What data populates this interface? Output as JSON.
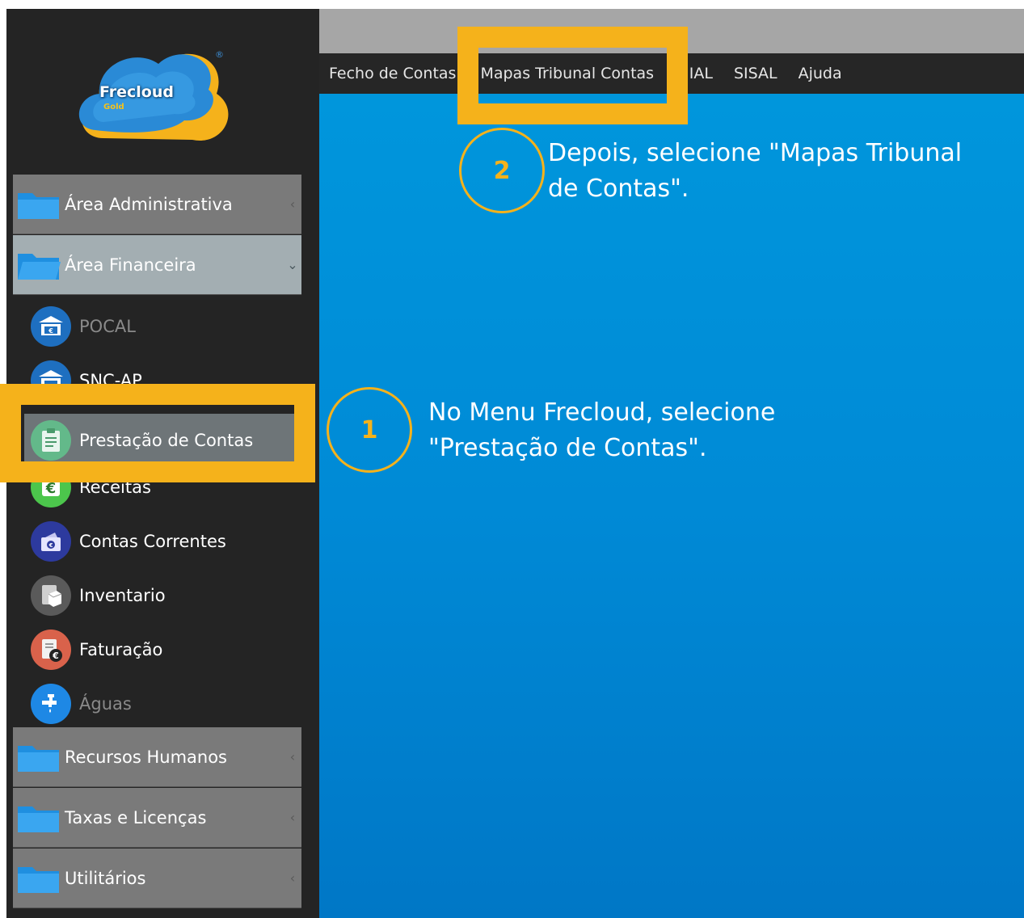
{
  "app": {
    "logo_text": "Frecloud",
    "logo_sub": "Gold",
    "logo_reg": "®"
  },
  "sidebar": {
    "areas": [
      {
        "label": "Área Administrativa",
        "expanded": false
      },
      {
        "label": "Área Financeira",
        "expanded": true
      },
      {
        "label": "Recursos Humanos",
        "expanded": false
      },
      {
        "label": "Taxas e Licenças",
        "expanded": false
      },
      {
        "label": "Utilitários",
        "expanded": false
      }
    ],
    "financeira_items": [
      {
        "label": "POCAL",
        "icon": "bank-icon",
        "enabled": false
      },
      {
        "label": "SNC-AP",
        "icon": "bank-icon",
        "enabled": true
      },
      {
        "label": "Prestação de Contas",
        "icon": "clipboard-icon",
        "enabled": true,
        "selected": true
      },
      {
        "label": "Receitas",
        "icon": "euro-icon",
        "enabled": true
      },
      {
        "label": "Contas Correntes",
        "icon": "wallet-icon",
        "enabled": true
      },
      {
        "label": "Inventario",
        "icon": "inventory-icon",
        "enabled": true
      },
      {
        "label": "Faturação",
        "icon": "invoice-icon",
        "enabled": true
      },
      {
        "label": "Águas",
        "icon": "water-tap-icon",
        "enabled": false
      }
    ]
  },
  "menubar": {
    "items": [
      "Fecho de Contas",
      "Mapas Tribunal Contas",
      "SIIAL",
      "SISAL",
      "Ajuda"
    ]
  },
  "annotations": {
    "step1": {
      "number": "1",
      "text_line1": "No Menu Frecloud, selecione",
      "text_line2": "\"Prestação de Contas\"."
    },
    "step2": {
      "number": "2",
      "text_line1": "Depois, selecione \"Mapas Tribunal",
      "text_line2": "de Contas\"."
    }
  },
  "colors": {
    "highlight": "#f5b21b",
    "content_blue": "#0096dc",
    "sidebar_bg": "#242424"
  }
}
